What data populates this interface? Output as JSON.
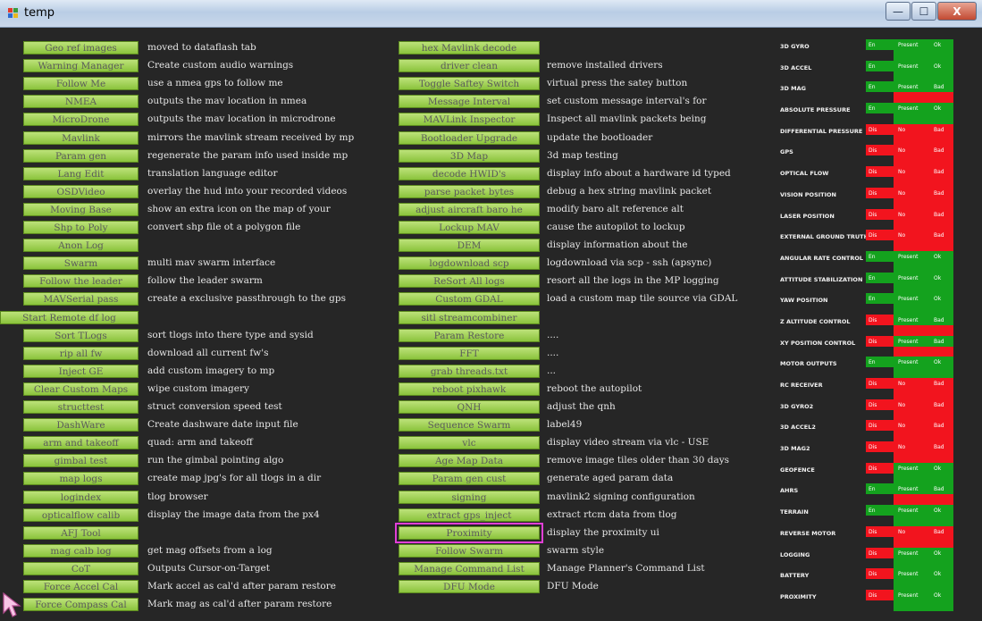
{
  "window": {
    "title": "temp",
    "minimize": "—",
    "maximize": "☐",
    "close": "X"
  },
  "col1": [
    {
      "label": "Geo ref images",
      "desc": "moved to dataflash tab"
    },
    {
      "label": "Warning Manager",
      "desc": "Create custom audio warnings"
    },
    {
      "label": "Follow Me",
      "desc": "use a nmea gps to follow me"
    },
    {
      "label": "NMEA",
      "desc": "outputs the mav location in nmea"
    },
    {
      "label": "MicroDrone",
      "desc": "outputs the mav location in microdrone"
    },
    {
      "label": "Mavlink",
      "desc": "mirrors the mavlink stream received by mp"
    },
    {
      "label": "Param gen",
      "desc": "regenerate the param info used inside mp"
    },
    {
      "label": "Lang Edit",
      "desc": "translation language editor"
    },
    {
      "label": "OSDVideo",
      "desc": "overlay the hud into your recorded videos"
    },
    {
      "label": "Moving Base",
      "desc": "show an extra icon on the map of your"
    },
    {
      "label": "Shp to Poly",
      "desc": "convert shp file ot a polygon file"
    },
    {
      "label": "Anon Log",
      "desc": ""
    },
    {
      "label": "Swarm",
      "desc": "multi mav swarm interface"
    },
    {
      "label": "Follow the leader",
      "desc": "follow the leader swarm"
    },
    {
      "label": "MAVSerial pass",
      "desc": "create a exclusive passthrough to the gps"
    },
    {
      "label": "Start Remote df log",
      "desc": ""
    },
    {
      "label": "Sort TLogs",
      "desc": "sort tlogs into there type and sysid"
    },
    {
      "label": "rip all fw",
      "desc": "download all current fw's"
    },
    {
      "label": "Inject GE",
      "desc": "add custom imagery to mp"
    },
    {
      "label": "Clear Custom Maps",
      "desc": "wipe custom imagery"
    },
    {
      "label": "structtest",
      "desc": "struct conversion speed test"
    },
    {
      "label": "DashWare",
      "desc": "Create dashware date input file"
    },
    {
      "label": "arm and takeoff",
      "desc": "quad: arm and takeoff"
    },
    {
      "label": "gimbal test",
      "desc": "run the gimbal pointing algo"
    },
    {
      "label": "map logs",
      "desc": "create map jpg's for all tlogs in a dir"
    },
    {
      "label": "logindex",
      "desc": "tlog browser"
    },
    {
      "label": "opticalflow calib",
      "desc": "display the image data from the px4"
    },
    {
      "label": "AFJ Tool",
      "desc": ""
    },
    {
      "label": "mag calb log",
      "desc": "get mag offsets from a log"
    },
    {
      "label": "CoT",
      "desc": "Outputs Cursor-on-Target"
    },
    {
      "label": "Force Accel Cal",
      "desc": "Mark accel as cal'd after param restore"
    },
    {
      "label": "Force Compass Cal",
      "desc": "Mark mag as cal'd after param restore"
    }
  ],
  "col2": [
    {
      "label": "hex Mavlink decode",
      "desc": ""
    },
    {
      "label": "driver clean",
      "desc": "remove installed drivers"
    },
    {
      "label": "Toggle Saftey Switch",
      "desc": "virtual press the satey button"
    },
    {
      "label": "Message Interval",
      "desc": "set custom message interval's for"
    },
    {
      "label": "MAVLink Inspector",
      "desc": "Inspect all mavlink packets being"
    },
    {
      "label": "Bootloader Upgrade",
      "desc": "update the bootloader"
    },
    {
      "label": "3D Map",
      "desc": "3d map testing"
    },
    {
      "label": "decode HWID's",
      "desc": "display info about a hardware id typed"
    },
    {
      "label": "parse packet bytes",
      "desc": "debug a hex string mavlink packet"
    },
    {
      "label": "adjust aircraft baro he",
      "desc": "modify baro alt reference alt"
    },
    {
      "label": "Lockup MAV",
      "desc": "cause the autopilot to lockup"
    },
    {
      "label": "DEM",
      "desc": "display information about the"
    },
    {
      "label": "logdownload scp",
      "desc": "logdownload via scp - ssh (apsync)"
    },
    {
      "label": "ReSort All logs",
      "desc": "resort all the logs in the MP logging"
    },
    {
      "label": "Custom GDAL",
      "desc": "load a custom map tile source via GDAL"
    },
    {
      "label": "sitl streamcombiner",
      "desc": ""
    },
    {
      "label": "Param Restore",
      "desc": "...."
    },
    {
      "label": "FFT",
      "desc": "...."
    },
    {
      "label": "grab threads.txt",
      "desc": "..."
    },
    {
      "label": "reboot pixhawk",
      "desc": "reboot the autopilot"
    },
    {
      "label": "QNH",
      "desc": "adjust the qnh"
    },
    {
      "label": "Sequence Swarm",
      "desc": "label49"
    },
    {
      "label": "vlc",
      "desc": "display video stream via vlc - USE"
    },
    {
      "label": "Age Map Data",
      "desc": "remove image tiles older than 30 days"
    },
    {
      "label": "Param gen cust",
      "desc": "generate aged param data"
    },
    {
      "label": "signing",
      "desc": "mavlink2 signing configuration"
    },
    {
      "label": "extract gps_inject",
      "desc": "extract rtcm data from tlog"
    },
    {
      "label": "Proximity",
      "desc": "display the proximity ui"
    },
    {
      "label": "Follow Swarm",
      "desc": "swarm style"
    },
    {
      "label": "Manage Command List",
      "desc": "Manage Planner's Command List"
    },
    {
      "label": "DFU Mode",
      "desc": "DFU Mode"
    }
  ],
  "sensors": [
    {
      "name": "3D GYRO",
      "en": "En",
      "present": "Present",
      "health": "Ok",
      "c1": "g",
      "c2": "g",
      "c3": "g"
    },
    {
      "name": "3D ACCEL",
      "en": "En",
      "present": "Present",
      "health": "Ok",
      "c1": "g",
      "c2": "g",
      "c3": "g"
    },
    {
      "name": "3D MAG",
      "en": "En",
      "present": "Present",
      "health": "Bad",
      "c1": "g",
      "c2": "g",
      "c3": "r"
    },
    {
      "name": "ABSOLUTE PRESSURE",
      "en": "En",
      "present": "Present",
      "health": "Ok",
      "c1": "g",
      "c2": "g",
      "c3": "g"
    },
    {
      "name": "DIFFERENTIAL PRESSURE",
      "en": "Dis",
      "present": "No",
      "health": "Bad",
      "c1": "r",
      "c2": "r",
      "c3": "r"
    },
    {
      "name": "GPS",
      "en": "Dis",
      "present": "No",
      "health": "Bad",
      "c1": "r",
      "c2": "r",
      "c3": "r"
    },
    {
      "name": "OPTICAL FLOW",
      "en": "Dis",
      "present": "No",
      "health": "Bad",
      "c1": "r",
      "c2": "r",
      "c3": "r"
    },
    {
      "name": "VISION POSITION",
      "en": "Dis",
      "present": "No",
      "health": "Bad",
      "c1": "r",
      "c2": "r",
      "c3": "r"
    },
    {
      "name": "LASER POSITION",
      "en": "Dis",
      "present": "No",
      "health": "Bad",
      "c1": "r",
      "c2": "r",
      "c3": "r"
    },
    {
      "name": "EXTERNAL GROUND TRUTH",
      "en": "Dis",
      "present": "No",
      "health": "Bad",
      "c1": "r",
      "c2": "r",
      "c3": "r"
    },
    {
      "name": "ANGULAR RATE CONTROL",
      "en": "En",
      "present": "Present",
      "health": "Ok",
      "c1": "g",
      "c2": "g",
      "c3": "g"
    },
    {
      "name": "ATTITUDE STABILIZATION",
      "en": "En",
      "present": "Present",
      "health": "Ok",
      "c1": "g",
      "c2": "g",
      "c3": "g"
    },
    {
      "name": "YAW POSITION",
      "en": "En",
      "present": "Present",
      "health": "Ok",
      "c1": "g",
      "c2": "g",
      "c3": "g"
    },
    {
      "name": "Z ALTITUDE CONTROL",
      "en": "Dis",
      "present": "Present",
      "health": "Bad",
      "c1": "r",
      "c2": "g",
      "c3": "r"
    },
    {
      "name": "XY POSITION CONTROL",
      "en": "Dis",
      "present": "Present",
      "health": "Bad",
      "c1": "r",
      "c2": "g",
      "c3": "r"
    },
    {
      "name": "MOTOR OUTPUTS",
      "en": "En",
      "present": "Present",
      "health": "Ok",
      "c1": "g",
      "c2": "g",
      "c3": "g"
    },
    {
      "name": "RC RECEIVER",
      "en": "Dis",
      "present": "No",
      "health": "Bad",
      "c1": "r",
      "c2": "r",
      "c3": "r"
    },
    {
      "name": "3D GYRO2",
      "en": "Dis",
      "present": "No",
      "health": "Bad",
      "c1": "r",
      "c2": "r",
      "c3": "r"
    },
    {
      "name": "3D ACCEL2",
      "en": "Dis",
      "present": "No",
      "health": "Bad",
      "c1": "r",
      "c2": "r",
      "c3": "r"
    },
    {
      "name": "3D MAG2",
      "en": "Dis",
      "present": "No",
      "health": "Bad",
      "c1": "r",
      "c2": "r",
      "c3": "r"
    },
    {
      "name": "GEOFENCE",
      "en": "Dis",
      "present": "Present",
      "health": "Ok",
      "c1": "r",
      "c2": "g",
      "c3": "g"
    },
    {
      "name": "AHRS",
      "en": "En",
      "present": "Present",
      "health": "Bad",
      "c1": "g",
      "c2": "g",
      "c3": "r"
    },
    {
      "name": "TERRAIN",
      "en": "En",
      "present": "Present",
      "health": "Ok",
      "c1": "g",
      "c2": "g",
      "c3": "g"
    },
    {
      "name": "REVERSE MOTOR",
      "en": "Dis",
      "present": "No",
      "health": "Bad",
      "c1": "r",
      "c2": "r",
      "c3": "r"
    },
    {
      "name": "LOGGING",
      "en": "Dis",
      "present": "Present",
      "health": "Ok",
      "c1": "r",
      "c2": "g",
      "c3": "g"
    },
    {
      "name": "BATTERY",
      "en": "Dis",
      "present": "Present",
      "health": "Ok",
      "c1": "r",
      "c2": "g",
      "c3": "g"
    },
    {
      "name": "PROXIMITY",
      "en": "Dis",
      "present": "Present",
      "health": "Ok",
      "c1": "r",
      "c2": "g",
      "c3": "g"
    }
  ],
  "colors": {
    "ok": "#14a21e",
    "bad": "#f2141e",
    "button": "#a9d65a",
    "selected_outline": "#e13fd6"
  },
  "selected_button": "Proximity"
}
